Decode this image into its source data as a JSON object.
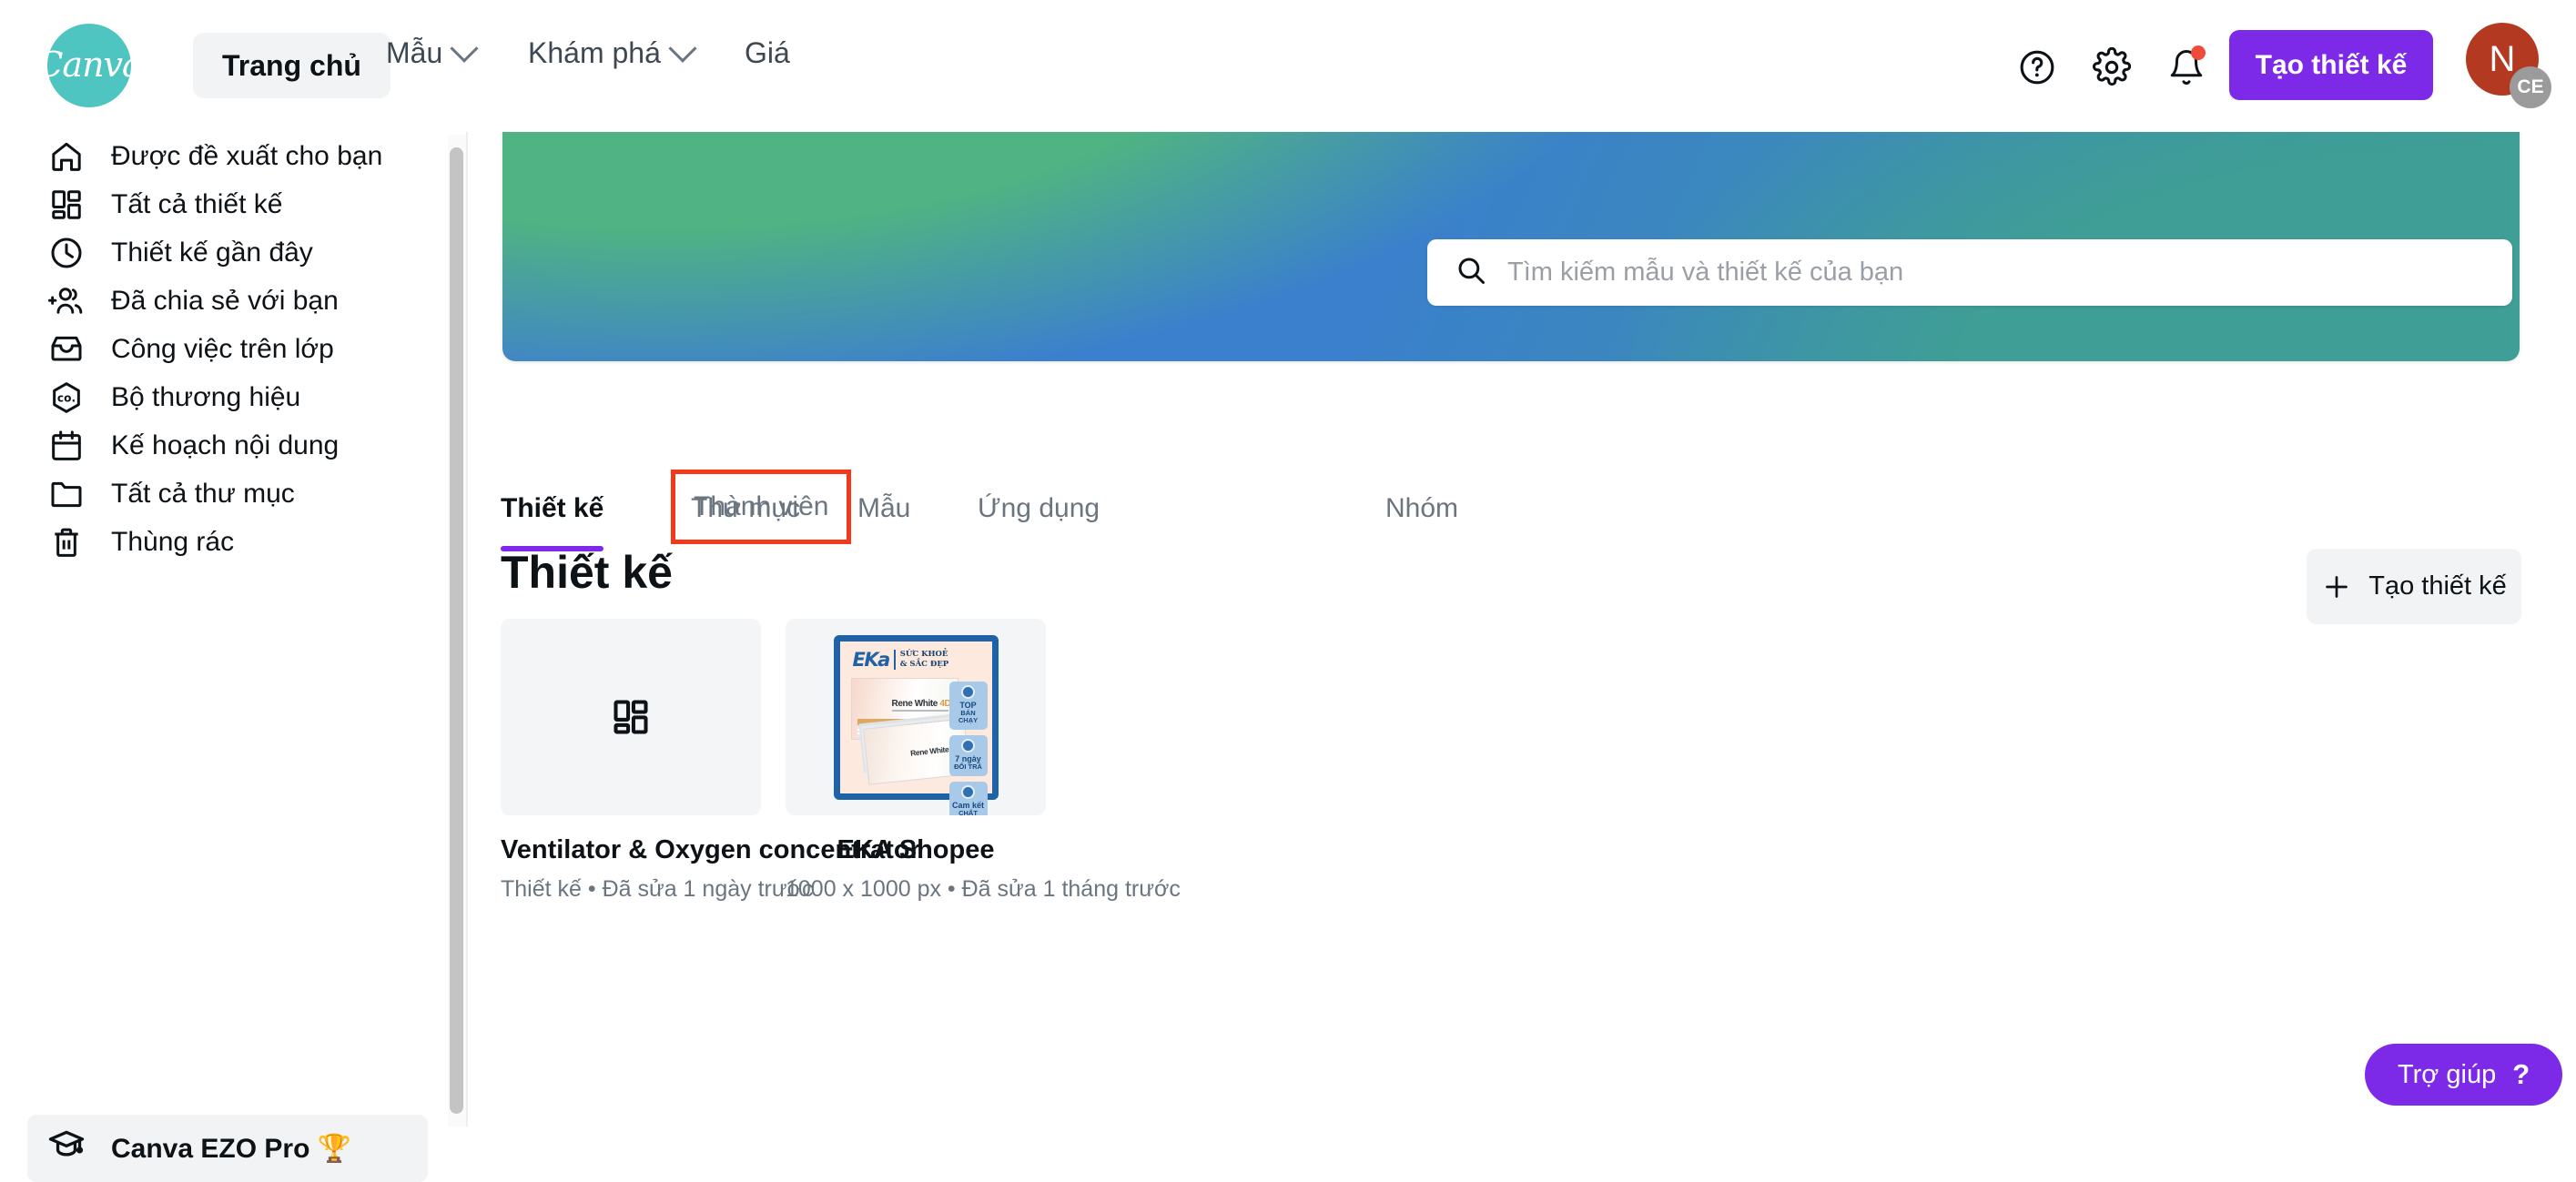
{
  "header": {
    "logo_text": "Canva",
    "nav": [
      {
        "label": "Trang chủ",
        "icon": "",
        "active": true
      },
      {
        "label": "Mẫu",
        "icon": "chevron-down-icon"
      },
      {
        "label": "Khám phá",
        "icon": "chevron-down-icon"
      },
      {
        "label": "Giá",
        "icon": ""
      }
    ],
    "help_icon": "question-circle-icon",
    "settings_icon": "gear-icon",
    "notifications_icon": "bell-icon",
    "create_button": "Tạo thiết kế",
    "avatar_initial": "N",
    "avatar_badge": "CE"
  },
  "search": {
    "placeholder": "Tìm kiếm mẫu và thiết kế của bạn",
    "value": "",
    "icon": "search-icon"
  },
  "sidebar": {
    "items": [
      {
        "label": "Được đề xuất cho bạn",
        "icon": "home-icon"
      },
      {
        "label": "Tất cả thiết kế",
        "icon": "grid-icon"
      },
      {
        "label": "Thiết kế gần đây",
        "icon": "clock-icon"
      },
      {
        "label": "Đã chia sẻ với bạn",
        "icon": "add-people-icon"
      },
      {
        "label": "Công việc trên lớp",
        "icon": "inbox-icon"
      },
      {
        "label": "Bộ thương hiệu",
        "icon": "brand-hexagon-icon"
      },
      {
        "label": "Kế hoạch nội dung",
        "icon": "calendar-icon"
      },
      {
        "label": "Tất cả thư mục",
        "icon": "folder-icon"
      },
      {
        "label": "Thùng rác",
        "icon": "trash-icon"
      }
    ],
    "pro": {
      "label": "Canva EZO Pro 🏆",
      "icon": "graduation-cap-icon"
    }
  },
  "tabs": [
    {
      "label": "Thiết kế",
      "active": true
    },
    {
      "label": "Thư mục",
      "active": false
    },
    {
      "label": "Mẫu",
      "active": false
    },
    {
      "label": "Ứng dụng",
      "active": false
    },
    {
      "label": "Thành viên",
      "active": false,
      "highlighted": true
    },
    {
      "label": "Nhóm",
      "active": false
    }
  ],
  "main": {
    "section_title": "Thiết kế",
    "create_button": "Tạo thiết kế",
    "create_button_icon": "plus-icon"
  },
  "cards": [
    {
      "title": "Ventilator & Oxygen concentrator",
      "subtitle": "Thiết kế • Đã sửa 1 ngày trước",
      "thumb_type": "placeholder",
      "thumb_icon": "grid-icon"
    },
    {
      "title": "EKA Shopee",
      "subtitle": "1000 x 1000 px • Đã sửa 1 tháng trước",
      "thumb_type": "image",
      "artwork": {
        "brand": "EKa",
        "slogan_line1": "SỨC KHOẺ",
        "slogan_line2": "& SẮC ĐẸP",
        "product_name": "Rene White",
        "product_suffix": "4D",
        "badges": [
          {
            "line1": "TOP",
            "line2": "BÁN CHẠY"
          },
          {
            "line1": "7 ngày",
            "line2": "ĐỔI TRẢ"
          },
          {
            "line1": "Cam kết",
            "line2": "CHẤT LƯỢNG"
          }
        ]
      }
    }
  ],
  "help": {
    "label": "Trợ giúp",
    "glyph": "?"
  },
  "colors": {
    "brand_teal": "#4ec5c1",
    "accent_purple": "#7d2ae8",
    "highlight_red": "#f4381a",
    "avatar_red": "#b33a21"
  }
}
